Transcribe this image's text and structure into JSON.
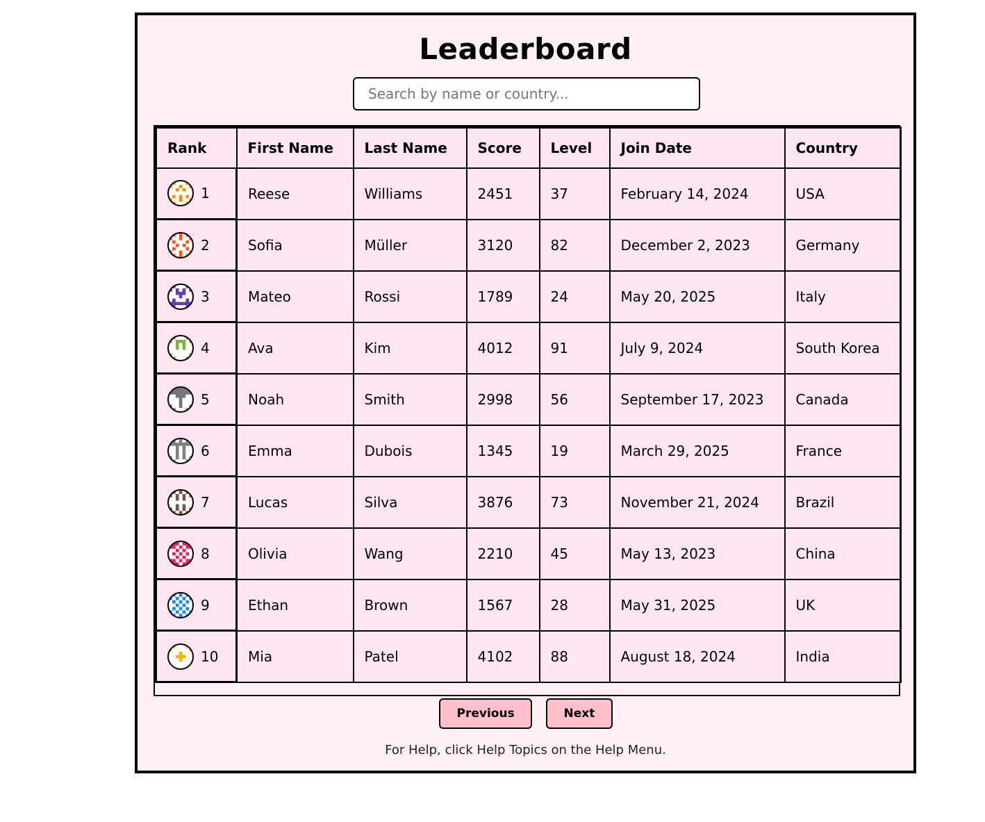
{
  "title": "Leaderboard",
  "search": {
    "placeholder": "Search by name or country...",
    "value": ""
  },
  "columns": [
    "Rank",
    "First Name",
    "Last Name",
    "Score",
    "Level",
    "Join Date",
    "Country"
  ],
  "rows": [
    {
      "rank": "1",
      "first": "Reese",
      "last": "Williams",
      "score": "2451",
      "level": "37",
      "join": "February 14, 2024",
      "country": "USA",
      "avatar_color": "#ff8c00",
      "avatar_icon": "pixel-face-avatar-icon"
    },
    {
      "rank": "2",
      "first": "Sofia",
      "last": "Müller",
      "score": "3120",
      "level": "82",
      "join": "December 2, 2023",
      "country": "Germany",
      "avatar_color": "#ff5722",
      "avatar_icon": "pixel-face-avatar-icon"
    },
    {
      "rank": "3",
      "first": "Mateo",
      "last": "Rossi",
      "score": "1789",
      "level": "24",
      "join": "May 20, 2025",
      "country": "Italy",
      "avatar_color": "#673ab7",
      "avatar_icon": "pixel-face-avatar-icon"
    },
    {
      "rank": "4",
      "first": "Ava",
      "last": "Kim",
      "score": "4012",
      "level": "91",
      "join": "July 9, 2024",
      "country": "South Korea",
      "avatar_color": "#7cb342",
      "avatar_icon": "pixel-face-avatar-icon"
    },
    {
      "rank": "5",
      "first": "Noah",
      "last": "Smith",
      "score": "2998",
      "level": "56",
      "join": "September 17, 2023",
      "country": "Canada",
      "avatar_color": "#757575",
      "avatar_icon": "pixel-face-avatar-icon"
    },
    {
      "rank": "6",
      "first": "Emma",
      "last": "Dubois",
      "score": "1345",
      "level": "19",
      "join": "March 29, 2025",
      "country": "France",
      "avatar_color": "#808080",
      "avatar_icon": "pixel-face-avatar-icon"
    },
    {
      "rank": "7",
      "first": "Lucas",
      "last": "Silva",
      "score": "3876",
      "level": "73",
      "join": "November 21, 2024",
      "country": "Brazil",
      "avatar_color": "#795548",
      "avatar_icon": "pixel-face-avatar-icon"
    },
    {
      "rank": "8",
      "first": "Olivia",
      "last": "Wang",
      "score": "2210",
      "level": "45",
      "join": "May 13, 2023",
      "country": "China",
      "avatar_color": "#e91e63",
      "avatar_icon": "pixel-face-avatar-icon"
    },
    {
      "rank": "9",
      "first": "Ethan",
      "last": "Brown",
      "score": "1567",
      "level": "28",
      "join": "May 31, 2025",
      "country": "UK",
      "avatar_color": "#1e88e5",
      "avatar_icon": "pixel-face-avatar-icon"
    },
    {
      "rank": "10",
      "first": "Mia",
      "last": "Patel",
      "score": "4102",
      "level": "88",
      "join": "August 18, 2024",
      "country": "India",
      "avatar_color": "#ffb300",
      "avatar_icon": "pixel-face-avatar-icon"
    }
  ],
  "pagination": {
    "previous_label": "Previous",
    "next_label": "Next"
  },
  "help_text": "For Help, click Help Topics on the Help Menu.",
  "colors": {
    "panel_bg": "#fff0f5",
    "table_bg": "#ffe6f0",
    "button_bg": "#ffc0cb",
    "border": "#000000"
  }
}
